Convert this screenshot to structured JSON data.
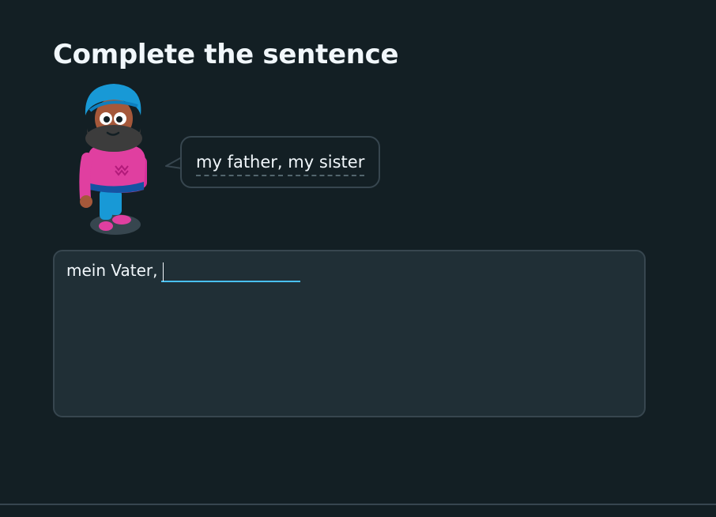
{
  "header": {
    "title": "Complete the sentence"
  },
  "character": {
    "name_icon": "character-illustration-icon"
  },
  "prompt": {
    "hint_words": [
      "my father,",
      "my sister"
    ]
  },
  "answer": {
    "prefix": "mein Vater,",
    "input_value": ""
  },
  "colors": {
    "background": "#131f24",
    "panel": "#202f36",
    "border": "#37464f",
    "input_underline": "#49c0f8",
    "text": "#f1f7fb"
  }
}
